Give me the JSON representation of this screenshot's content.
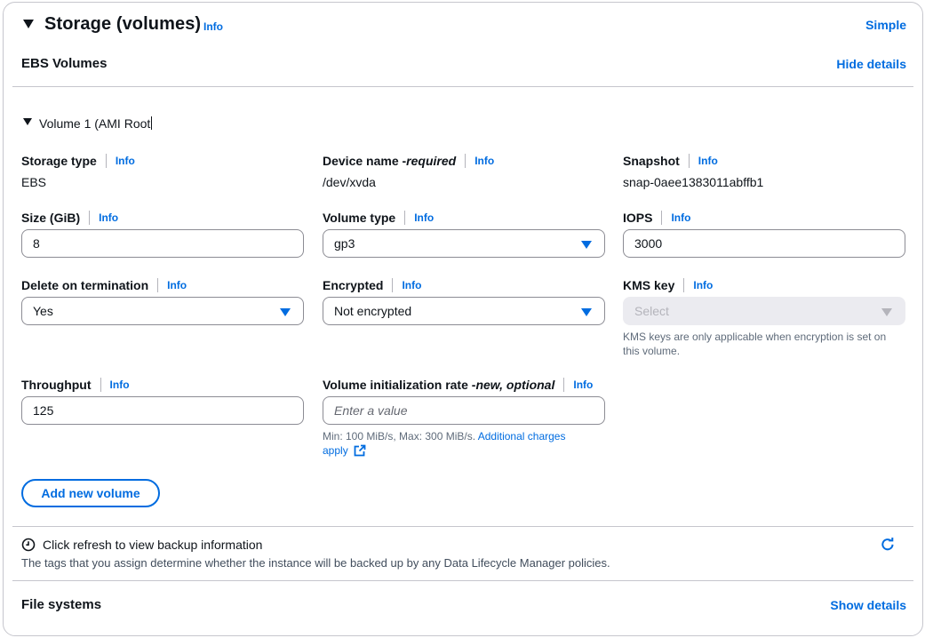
{
  "header": {
    "title": "Storage (volumes)",
    "info": "Info",
    "mode_link": "Simple"
  },
  "ebs": {
    "title": "EBS Volumes",
    "hide_details": "Hide details"
  },
  "volume": {
    "title": "Volume 1 (AMI Root",
    "storage_type": {
      "label": "Storage type",
      "info": "Info",
      "value": "EBS"
    },
    "device_name": {
      "label": "Device name - ",
      "required": "required",
      "info": "Info",
      "value": "/dev/xvda"
    },
    "snapshot": {
      "label": "Snapshot",
      "info": "Info",
      "value": "snap-0aee1383011abffb1"
    },
    "size": {
      "label": "Size (GiB)",
      "info": "Info",
      "value": "8"
    },
    "volume_type": {
      "label": "Volume type",
      "info": "Info",
      "value": "gp3"
    },
    "iops": {
      "label": "IOPS",
      "info": "Info",
      "value": "3000"
    },
    "delete_on_termination": {
      "label": "Delete on termination",
      "info": "Info",
      "value": "Yes"
    },
    "encrypted": {
      "label": "Encrypted",
      "info": "Info",
      "value": "Not encrypted"
    },
    "kms_key": {
      "label": "KMS key",
      "info": "Info",
      "placeholder": "Select",
      "hint": "KMS keys are only applicable when encryption is set on this volume."
    },
    "throughput": {
      "label": "Throughput",
      "info": "Info",
      "value": "125"
    },
    "init_rate": {
      "label": "Volume initialization rate - ",
      "qualifier": "new, optional",
      "info": "Info",
      "placeholder": "Enter a value",
      "hint": "Min: 100 MiB/s, Max: 300 MiB/s. ",
      "hint_link": "Additional charges apply"
    }
  },
  "add_volume_button": "Add new volume",
  "backup": {
    "title": "Click refresh to view backup information",
    "description": "The tags that you assign determine whether the instance will be backed up by any Data Lifecycle Manager policies."
  },
  "file_systems": {
    "title": "File systems",
    "show_details": "Show details"
  },
  "colors": {
    "link": "#006ce0",
    "border": "#c6c6cd",
    "text": "#0f141a"
  }
}
